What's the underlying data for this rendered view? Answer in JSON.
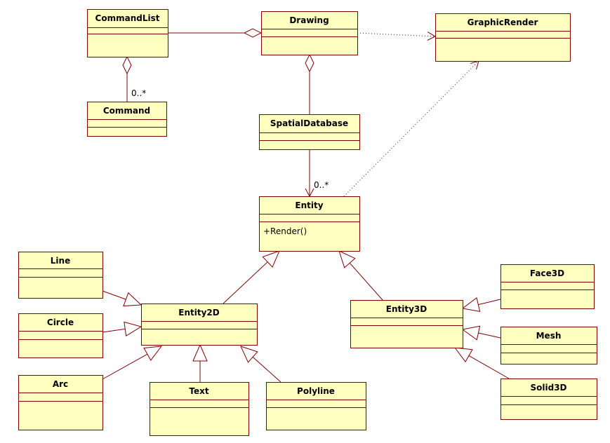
{
  "diagram": {
    "colors": {
      "class_fill": "#ffffc0",
      "class_border": "#800000",
      "line": "#800000"
    },
    "classes": [
      {
        "id": "commandlist",
        "name": "CommandList",
        "methods": []
      },
      {
        "id": "drawing",
        "name": "Drawing",
        "methods": []
      },
      {
        "id": "graphicrender",
        "name": "GraphicRender",
        "methods": []
      },
      {
        "id": "command",
        "name": "Command",
        "methods": []
      },
      {
        "id": "spatialdatabase",
        "name": "SpatialDatabase",
        "methods": []
      },
      {
        "id": "entity",
        "name": "Entity",
        "methods": [
          "+Render()"
        ]
      },
      {
        "id": "line",
        "name": "Line",
        "methods": []
      },
      {
        "id": "circle",
        "name": "Circle",
        "methods": []
      },
      {
        "id": "arc",
        "name": "Arc",
        "methods": []
      },
      {
        "id": "entity2d",
        "name": "Entity2D",
        "methods": []
      },
      {
        "id": "text",
        "name": "Text",
        "methods": []
      },
      {
        "id": "polyline",
        "name": "Polyline",
        "methods": []
      },
      {
        "id": "entity3d",
        "name": "Entity3D",
        "methods": []
      },
      {
        "id": "face3d",
        "name": "Face3D",
        "methods": []
      },
      {
        "id": "mesh",
        "name": "Mesh",
        "methods": []
      },
      {
        "id": "solid3d",
        "name": "Solid3D",
        "methods": []
      }
    ],
    "relations": [
      {
        "type": "aggregation",
        "from": "commandlist",
        "to": "drawing"
      },
      {
        "type": "dependency",
        "from": "drawing",
        "to": "graphicrender"
      },
      {
        "type": "aggregation",
        "from": "command",
        "to": "commandlist",
        "multiplicity": "0..*"
      },
      {
        "type": "aggregation",
        "from": "spatialdatabase",
        "to": "drawing"
      },
      {
        "type": "association",
        "from": "spatialdatabase",
        "to": "entity",
        "multiplicity": "0..*"
      },
      {
        "type": "dependency",
        "from": "entity",
        "to": "graphicrender"
      },
      {
        "type": "generalization",
        "from": "entity2d",
        "to": "entity"
      },
      {
        "type": "generalization",
        "from": "entity3d",
        "to": "entity"
      },
      {
        "type": "generalization",
        "from": "line",
        "to": "entity2d"
      },
      {
        "type": "generalization",
        "from": "circle",
        "to": "entity2d"
      },
      {
        "type": "generalization",
        "from": "arc",
        "to": "entity2d"
      },
      {
        "type": "generalization",
        "from": "text",
        "to": "entity2d"
      },
      {
        "type": "generalization",
        "from": "polyline",
        "to": "entity2d"
      },
      {
        "type": "generalization",
        "from": "face3d",
        "to": "entity3d"
      },
      {
        "type": "generalization",
        "from": "mesh",
        "to": "entity3d"
      },
      {
        "type": "generalization",
        "from": "solid3d",
        "to": "entity3d"
      }
    ]
  }
}
